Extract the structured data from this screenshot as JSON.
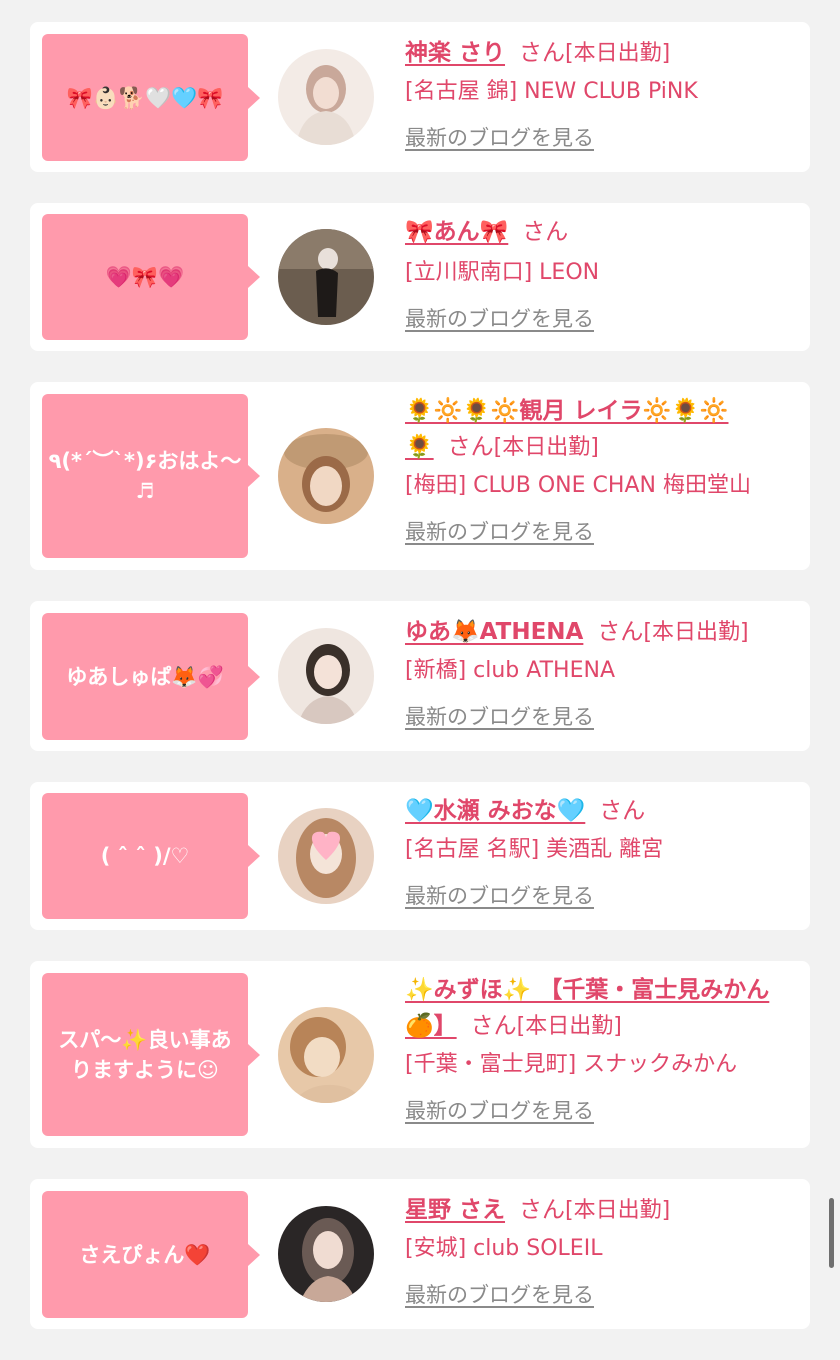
{
  "cards": [
    {
      "bubble": "🎀👶🏻🐕🤍🩵🎀",
      "name": "神楽 さり",
      "name_cont": "",
      "san": "さん",
      "status": "[本日出勤]",
      "shop": "[名古屋 錦] NEW CLUB PiNK",
      "blog": "最新のブログを見る",
      "avatar_colors": [
        "#f3ebe6",
        "#c9a89a",
        "#e8ddd5"
      ]
    },
    {
      "bubble": "💗🎀💗",
      "name": "🎀あん🎀",
      "name_cont": "",
      "san": "さん",
      "status": "",
      "shop": "[立川駅南口] LEON",
      "blog": "最新のブログを見る",
      "avatar_colors": [
        "#6b5d4f",
        "#2a2420",
        "#8b7b6a"
      ]
    },
    {
      "bubble": "٩(*´︶`*)۶おはよ〜♬",
      "name": "🌻🔆🌻🔆観月 レイラ🔆🌻🔆",
      "name_cont": "🌻",
      "san": "さん",
      "status": "[本日出勤]",
      "shop": "[梅田] CLUB ONE CHAN 梅田堂山",
      "blog": "最新のブログを見る",
      "avatar_colors": [
        "#d9b08a",
        "#9b6a48",
        "#e8c9a8"
      ]
    },
    {
      "bubble": "ゆあしゅぱ🦊💞",
      "name": "ゆあ🦊ATHENA",
      "name_cont": "",
      "san": "さん",
      "status": "[本日出勤]",
      "shop": "[新橋] club ATHENA",
      "blog": "最新のブログを見る",
      "avatar_colors": [
        "#efe6e0",
        "#3a302a",
        "#d8c8c0"
      ]
    },
    {
      "bubble": "( ˆ ˆ )/♡",
      "name": "🩵水瀬 みおな🩵",
      "name_cont": "",
      "san": "さん",
      "status": "",
      "shop": "[名古屋 名駅] 美酒乱 離宮",
      "blog": "最新のブログを見る",
      "avatar_colors": [
        "#e8d2c2",
        "#b88864",
        "#f4e4d8"
      ]
    },
    {
      "bubble": "スパ〜✨良い事ありますように☺",
      "name": "✨みずほ✨ 【千葉・富士見みかん",
      "name_cont": "🍊】",
      "san": "さん",
      "status": "[本日出勤]",
      "shop": "[千葉・富士見町] スナックみかん",
      "blog": "最新のブログを見る",
      "avatar_colors": [
        "#e7c8a8",
        "#b88458",
        "#f2dcc4"
      ]
    },
    {
      "bubble": "さえぴょん❤️",
      "name": "星野 さえ",
      "name_cont": "",
      "san": "さん",
      "status": "[本日出勤]",
      "shop": "[安城] club SOLEIL",
      "blog": "最新のブログを見る",
      "avatar_colors": [
        "#2a2626",
        "#c8a898",
        "#6a5a54"
      ]
    }
  ]
}
